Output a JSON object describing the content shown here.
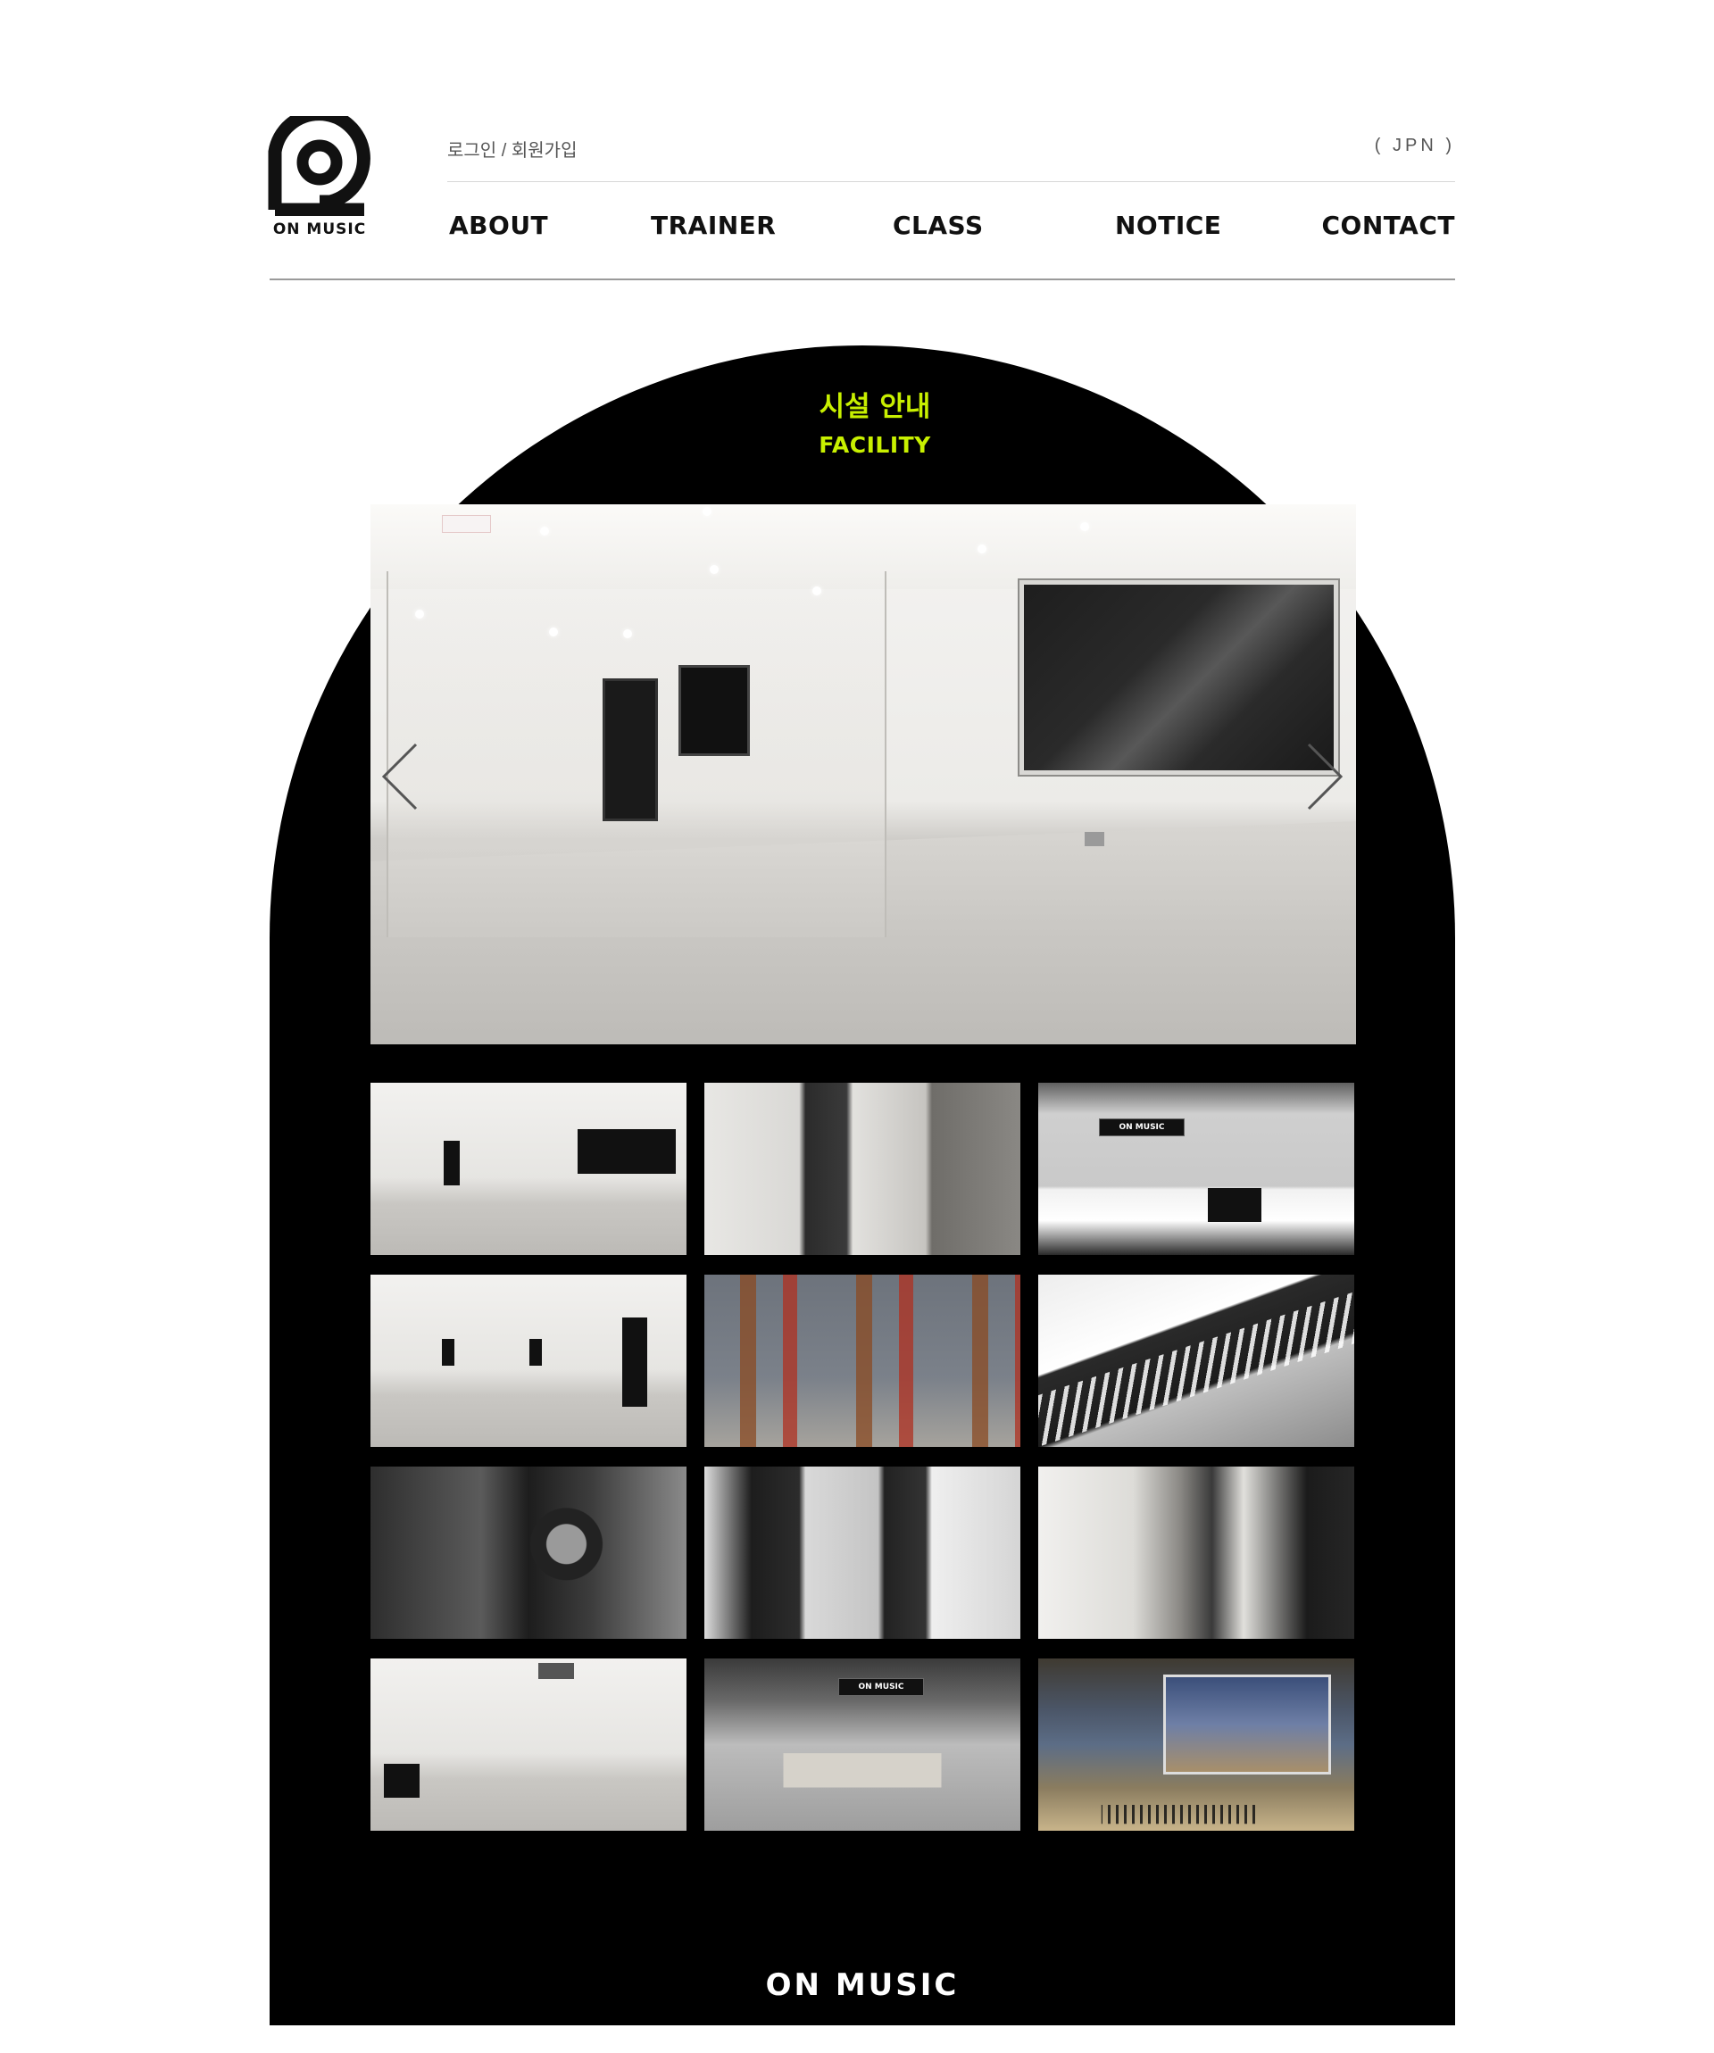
{
  "brand": {
    "logo_text": "ON MUSIC",
    "footer_text": "ON MUSIC"
  },
  "header": {
    "login_label": "로그인 / 회원가입",
    "language_label": "( JPN )",
    "nav": [
      {
        "label": "ABOUT"
      },
      {
        "label": "TRAINER"
      },
      {
        "label": "CLASS"
      },
      {
        "label": "NOTICE"
      },
      {
        "label": "CONTACT"
      }
    ]
  },
  "facility": {
    "title_ko": "시설 안내",
    "title_en": "FACILITY",
    "accent_color": "#c8f000",
    "main_photo": {
      "subject": "studio-room"
    },
    "prev_icon": "chevron-left-icon",
    "next_icon": "chevron-right-icon",
    "thumbnails": [
      {
        "subject": "studio-room"
      },
      {
        "subject": "hallway-doors"
      },
      {
        "subject": "reception-lounge"
      },
      {
        "subject": "practice-room"
      },
      {
        "subject": "guitar-wall"
      },
      {
        "subject": "keyboard"
      },
      {
        "subject": "recording-mic"
      },
      {
        "subject": "glass-doors"
      },
      {
        "subject": "corridor"
      },
      {
        "subject": "large-studio"
      },
      {
        "subject": "lobby-sofa"
      },
      {
        "subject": "producer-desk"
      }
    ],
    "thumbnail_sign_text": "ON MUSIC"
  }
}
